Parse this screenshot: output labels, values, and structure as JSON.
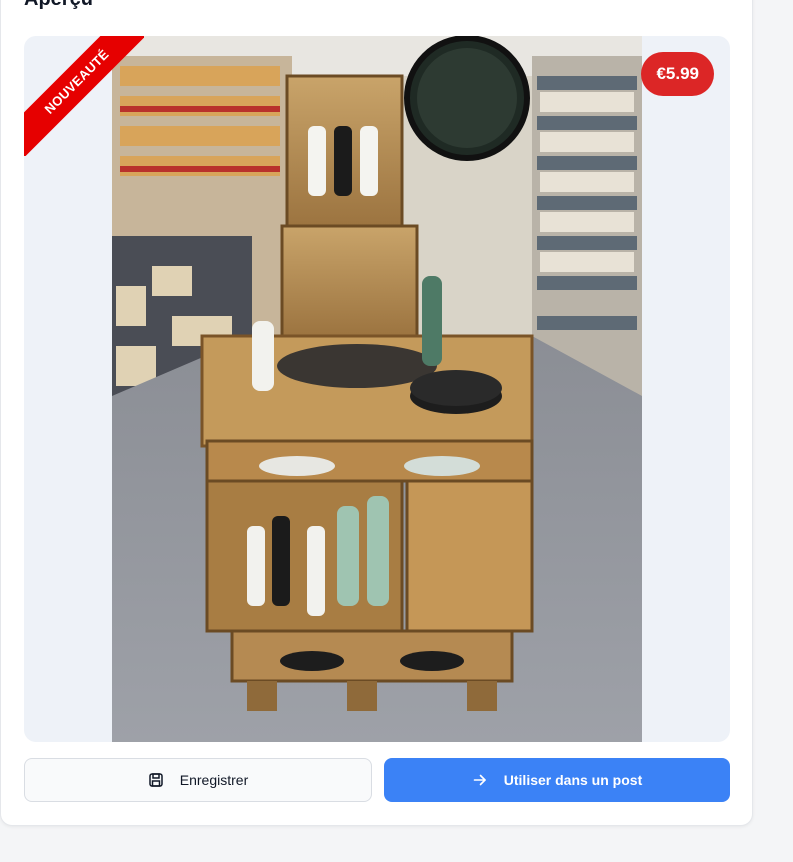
{
  "preview_section": {
    "title": "Aperçu",
    "ribbon_label": "NOUVEAUTÉ",
    "price_label": "€5.99"
  },
  "actions": {
    "save_label": "Enregistrer",
    "use_label": "Utiliser dans un post",
    "save_icon": "floppy-disk-icon",
    "use_icon": "arrow-right-icon"
  },
  "colors": {
    "ribbon": "#e60000",
    "price_badge": "#dc2626",
    "primary_button": "#3b82f6"
  }
}
